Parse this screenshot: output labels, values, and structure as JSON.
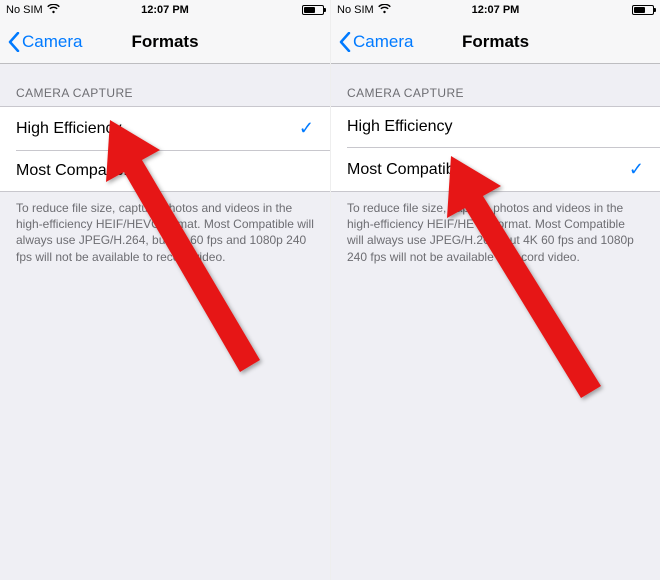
{
  "screens": [
    {
      "statusbar": {
        "carrier": "No SIM",
        "time": "12:07 PM"
      },
      "nav": {
        "back_label": "Camera",
        "title": "Formats"
      },
      "section_header": "CAMERA CAPTURE",
      "options": {
        "high_efficiency": "High Efficiency",
        "most_compatible": "Most Compatible",
        "selected": "high_efficiency"
      },
      "footer": "To reduce file size, capture photos and videos in the high-efficiency HEIF/HEVC format. Most Compatible will always use JPEG/H.264, but 4K 60 fps and 1080p 240 fps will not be available to record video."
    },
    {
      "statusbar": {
        "carrier": "No SIM",
        "time": "12:07 PM"
      },
      "nav": {
        "back_label": "Camera",
        "title": "Formats"
      },
      "section_header": "CAMERA CAPTURE",
      "options": {
        "high_efficiency": "High Efficiency",
        "most_compatible": "Most Compatible",
        "selected": "most_compatible"
      },
      "footer": "To reduce file size, capture photos and videos in the high-efficiency HEIF/HEVC format. Most Compatible will always use JPEG/H.264, but 4K 60 fps and 1080p 240 fps will not be available to record video."
    }
  ],
  "checkmark_glyph": "✓"
}
